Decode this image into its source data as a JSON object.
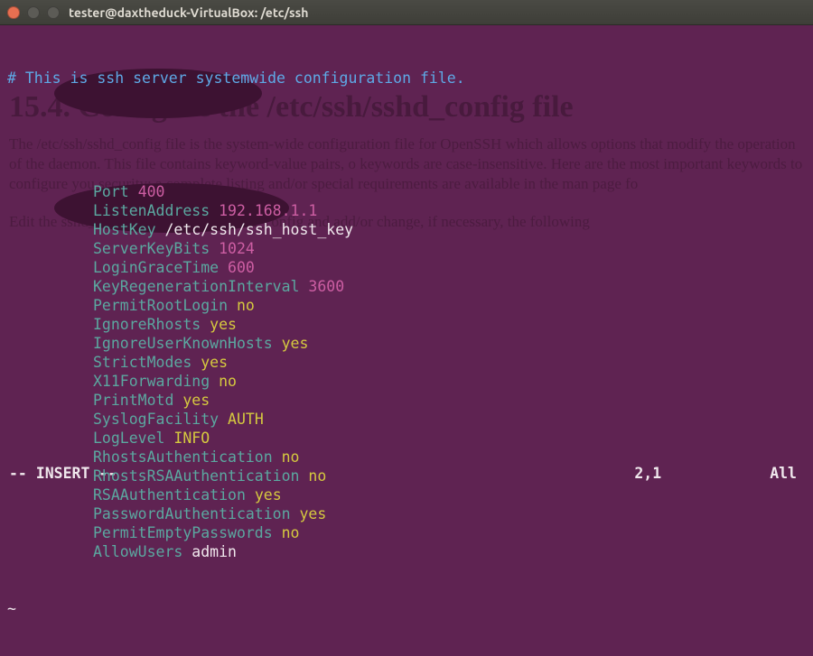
{
  "window": {
    "title": "tester@daxtheduck-VirtualBox: /etc/ssh"
  },
  "comment_line": "# This is ssh server systemwide configuration file.",
  "config": [
    {
      "key": "Port",
      "val": "400",
      "cls": "val-magenta"
    },
    {
      "key": "ListenAddress",
      "val": "192.168.1.1",
      "cls": "val-magenta"
    },
    {
      "key": "HostKey",
      "val": "/etc/ssh/ssh_host_key",
      "cls": "val-white"
    },
    {
      "key": "ServerKeyBits",
      "val": "1024",
      "cls": "val-magenta"
    },
    {
      "key": "LoginGraceTime",
      "val": "600",
      "cls": "val-magenta"
    },
    {
      "key": "KeyRegenerationInterval",
      "val": "3600",
      "cls": "val-magenta"
    },
    {
      "key": "PermitRootLogin",
      "val": "no",
      "cls": "val-yellow"
    },
    {
      "key": "IgnoreRhosts",
      "val": "yes",
      "cls": "val-yellow"
    },
    {
      "key": "IgnoreUserKnownHosts",
      "val": "yes",
      "cls": "val-yellow"
    },
    {
      "key": "StrictModes",
      "val": "yes",
      "cls": "val-yellow"
    },
    {
      "key": "X11Forwarding",
      "val": "no",
      "cls": "val-yellow"
    },
    {
      "key": "PrintMotd",
      "val": "yes",
      "cls": "val-yellow"
    },
    {
      "key": "SyslogFacility",
      "val": "AUTH",
      "cls": "val-yellow"
    },
    {
      "key": "LogLevel",
      "val": "INFO",
      "cls": "val-yellow"
    },
    {
      "key": "RhostsAuthentication",
      "val": "no",
      "cls": "val-yellow"
    },
    {
      "key": "RhostsRSAAuthentication",
      "val": "no",
      "cls": "val-yellow"
    },
    {
      "key": "RSAAuthentication",
      "val": "yes",
      "cls": "val-yellow"
    },
    {
      "key": "PasswordAuthentication",
      "val": "yes",
      "cls": "val-yellow"
    },
    {
      "key": "PermitEmptyPasswords",
      "val": "no",
      "cls": "val-yellow"
    },
    {
      "key": "AllowUsers",
      "val": "admin",
      "cls": "val-white"
    }
  ],
  "tilde": "~",
  "status": {
    "mode": "-- INSERT --",
    "pos": "2,1",
    "pct": "All"
  },
  "ghost": {
    "heading": "15.4. Configure the /etc/ssh/sshd_config file",
    "p1": "The /etc/ssh/sshd_config file is the system-wide configuration file for OpenSSH which allows options that modify the operation of the daemon. This file contains keyword-value pairs, o keywords are case-insensitive. Here are the most important keywords to configure you security; a complete listing and/or special requirements are available in the man page fo",
    "p2": "Edit the sshd_config file vi /etc/ssh/sshd_config and add/or change, if necessary, the following"
  }
}
